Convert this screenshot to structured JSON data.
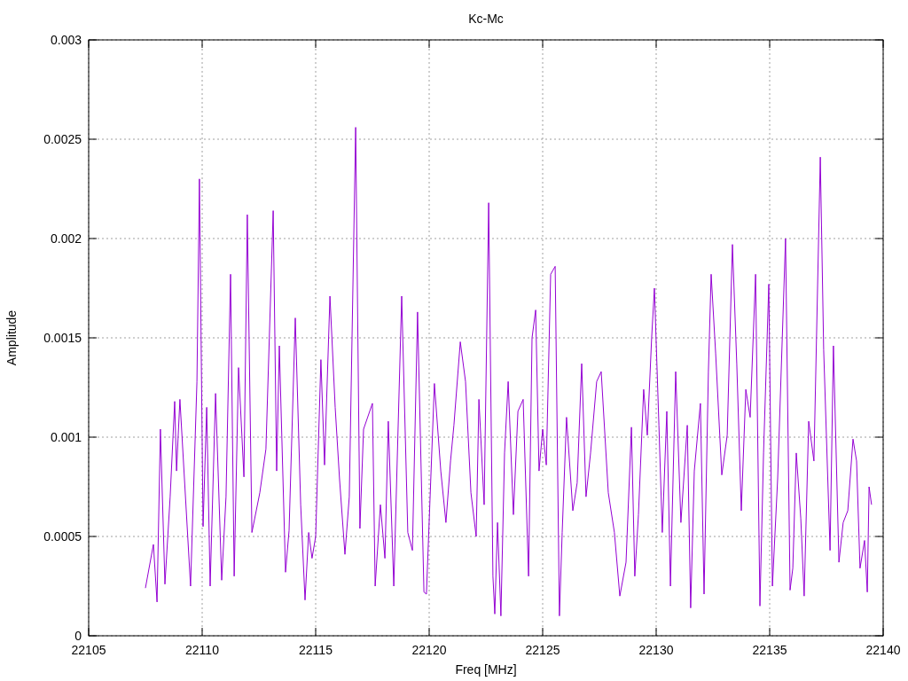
{
  "chart": {
    "chart_data": {
      "type": "line",
      "title": "Kc-Mc",
      "xlabel": "Freq [MHz]",
      "ylabel": "Amplitude",
      "x": [
        22107.5,
        22107.85,
        22108.01,
        22108.16,
        22108.36,
        22108.59,
        22108.79,
        22108.87,
        22109.02,
        22109.22,
        22109.49,
        22109.77,
        22109.88,
        22110.04,
        22110.2,
        22110.35,
        22110.59,
        22110.86,
        22111.05,
        22111.25,
        22111.41,
        22111.6,
        22111.84,
        22111.99,
        22112.19,
        22112.54,
        22112.81,
        22113.13,
        22113.28,
        22113.4,
        22113.67,
        22113.83,
        22114.1,
        22114.34,
        22114.53,
        22114.69,
        22114.84,
        22115.0,
        22115.23,
        22115.39,
        22115.63,
        22115.86,
        22116.05,
        22116.29,
        22116.48,
        22116.76,
        22116.95,
        22117.11,
        22117.5,
        22117.62,
        22117.85,
        22118.05,
        22118.2,
        22118.44,
        22118.79,
        22119.06,
        22119.26,
        22119.49,
        22119.77,
        22119.88,
        22120.23,
        22120.51,
        22120.74,
        22120.94,
        22121.09,
        22121.37,
        22121.6,
        22121.84,
        22122.07,
        22122.19,
        22122.42,
        22122.62,
        22122.81,
        22122.89,
        22123.01,
        22123.16,
        22123.32,
        22123.48,
        22123.71,
        22123.91,
        22124.14,
        22124.38,
        22124.53,
        22124.69,
        22124.84,
        22125.0,
        22125.16,
        22125.35,
        22125.55,
        22125.74,
        22125.86,
        22126.05,
        22126.33,
        22126.52,
        22126.72,
        22126.91,
        22127.11,
        22127.38,
        22127.58,
        22127.89,
        22128.16,
        22128.4,
        22128.67,
        22128.91,
        22129.06,
        22129.22,
        22129.45,
        22129.61,
        22129.8,
        22129.92,
        22130.12,
        22130.27,
        22130.47,
        22130.63,
        22130.86,
        22131.09,
        22131.37,
        22131.52,
        22131.68,
        22131.95,
        22132.11,
        22132.3,
        22132.42,
        22132.62,
        22132.89,
        22133.13,
        22133.36,
        22133.55,
        22133.75,
        22133.95,
        22134.14,
        22134.38,
        22134.57,
        22134.73,
        22134.96,
        22135.12,
        22135.35,
        22135.7,
        22135.9,
        22136.02,
        22136.17,
        22136.37,
        22136.52,
        22136.72,
        22136.95,
        22137.23,
        22137.38,
        22137.66,
        22137.81,
        22138.05,
        22138.24,
        22138.44,
        22138.67,
        22138.83,
        22138.98,
        22139.18,
        22139.3,
        22139.38,
        22139.49
      ],
      "series": [
        {
          "color": "#9400d3",
          "values": [
            0.00024,
            0.00046,
            0.00017,
            0.00104,
            0.00026,
            0.0007,
            0.00118,
            0.00083,
            0.00119,
            0.00079,
            0.00025,
            0.00128,
            0.0023,
            0.00055,
            0.00115,
            0.00025,
            0.00122,
            0.00028,
            0.0007,
            0.00182,
            0.0003,
            0.00135,
            0.0008,
            0.00212,
            0.00052,
            0.00072,
            0.00094,
            0.00214,
            0.00083,
            0.00146,
            0.00032,
            0.00053,
            0.0016,
            0.00066,
            0.00018,
            0.00052,
            0.00039,
            0.0005,
            0.00139,
            0.00086,
            0.00171,
            0.00115,
            0.00079,
            0.00041,
            0.0007,
            0.00256,
            0.00054,
            0.00104,
            0.00117,
            0.00025,
            0.00066,
            0.00039,
            0.00108,
            0.00025,
            0.00171,
            0.00052,
            0.00043,
            0.00163,
            0.00022,
            0.00021,
            0.00127,
            0.00083,
            0.00057,
            0.00088,
            0.00106,
            0.00148,
            0.00128,
            0.00072,
            0.0005,
            0.00119,
            0.00066,
            0.00218,
            0.0003,
            0.00011,
            0.00057,
            0.0001,
            0.00092,
            0.00128,
            0.00061,
            0.00113,
            0.00119,
            0.0003,
            0.0015,
            0.00164,
            0.00083,
            0.00104,
            0.00086,
            0.00182,
            0.00186,
            0.0001,
            0.00052,
            0.0011,
            0.00063,
            0.00077,
            0.00137,
            0.0007,
            0.00092,
            0.00128,
            0.00133,
            0.00072,
            0.00052,
            0.0002,
            0.00037,
            0.00105,
            0.0003,
            0.00061,
            0.00124,
            0.00101,
            0.0015,
            0.00175,
            0.00106,
            0.00052,
            0.00113,
            0.00025,
            0.00133,
            0.00057,
            0.00106,
            0.00014,
            0.00083,
            0.00117,
            0.00021,
            0.00133,
            0.00182,
            0.00142,
            0.00081,
            0.00101,
            0.00197,
            0.00137,
            0.00063,
            0.00124,
            0.0011,
            0.00182,
            0.00015,
            0.00092,
            0.00177,
            0.00025,
            0.00079,
            0.002,
            0.00023,
            0.00034,
            0.00092,
            0.00059,
            0.0002,
            0.00108,
            0.00088,
            0.00241,
            0.00144,
            0.00043,
            0.00146,
            0.00037,
            0.00057,
            0.00063,
            0.00099,
            0.00088,
            0.00034,
            0.00048,
            0.00022,
            0.00075,
            0.00066
          ]
        }
      ],
      "xlim": [
        22105,
        22140
      ],
      "ylim": [
        0,
        0.003
      ],
      "xticks": [
        22105,
        22110,
        22115,
        22120,
        22125,
        22130,
        22135,
        22140
      ],
      "yticks": [
        0,
        0.0005,
        0.001,
        0.0015,
        0.002,
        0.0025,
        0.003
      ],
      "grid": true
    }
  }
}
